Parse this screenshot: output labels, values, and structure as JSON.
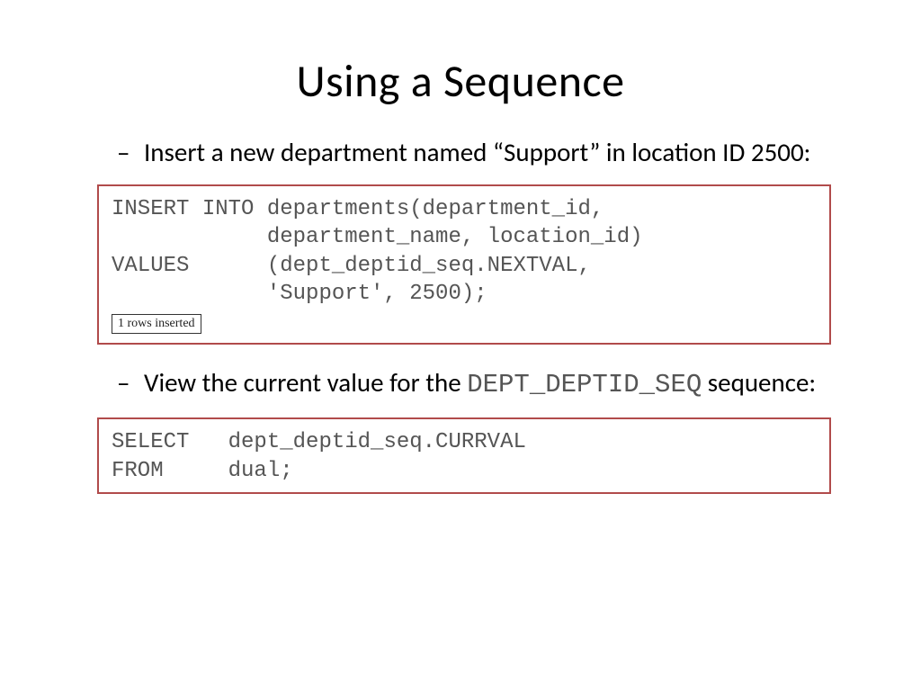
{
  "title": "Using a Sequence",
  "bullet1": "Insert a new department named “Support” in location ID 2500:",
  "code1_line1": "INSERT INTO departments(department_id,",
  "code1_line2": "            department_name, location_id)",
  "code1_line3": "VALUES      (dept_deptid_seq.NEXTVAL,",
  "code1_line4": "            'Support', 2500);",
  "result_chip": "1 rows inserted",
  "bullet2_pre": "View the current value for the ",
  "bullet2_seq": "DEPT_DEPTID_SEQ",
  "bullet2_post": " sequence:",
  "code2_line1": "SELECT   dept_deptid_seq.CURRVAL",
  "code2_line2": "FROM     dual;"
}
